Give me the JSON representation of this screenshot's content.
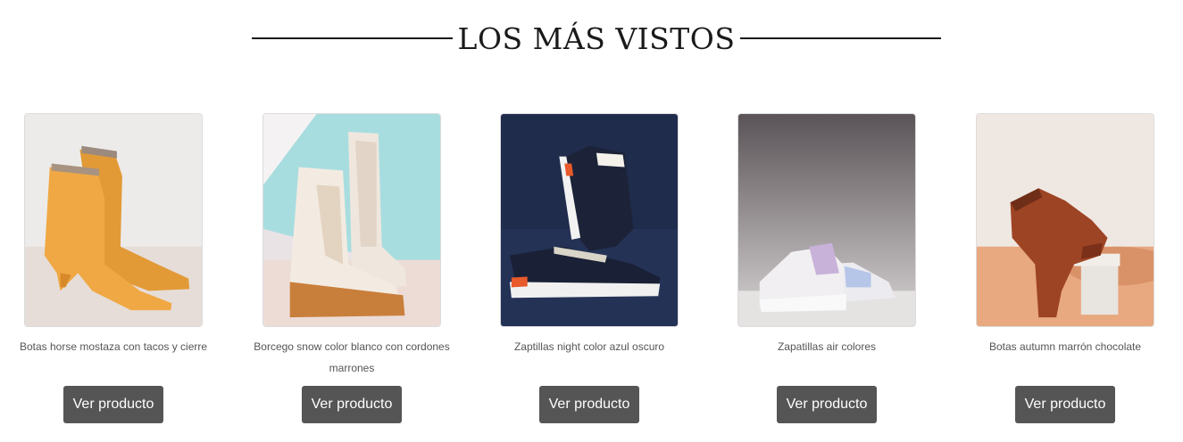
{
  "section": {
    "title": "LOS MÁS VISTOS"
  },
  "products": [
    {
      "name": "Botas horse mostaza con tacos y cierre",
      "button": "Ver producto"
    },
    {
      "name": "Borcego snow color blanco con cordones marrones",
      "button": "Ver producto"
    },
    {
      "name": "Zaptillas night color azul oscuro",
      "button": "Ver producto"
    },
    {
      "name": "Zapatillas air colores",
      "button": "Ver producto"
    },
    {
      "name": "Botas autumn marrón chocolate",
      "button": "Ver producto"
    }
  ],
  "colors": {
    "button_bg": "#555555",
    "button_text": "#ffffff",
    "title": "#1a1a1a"
  }
}
